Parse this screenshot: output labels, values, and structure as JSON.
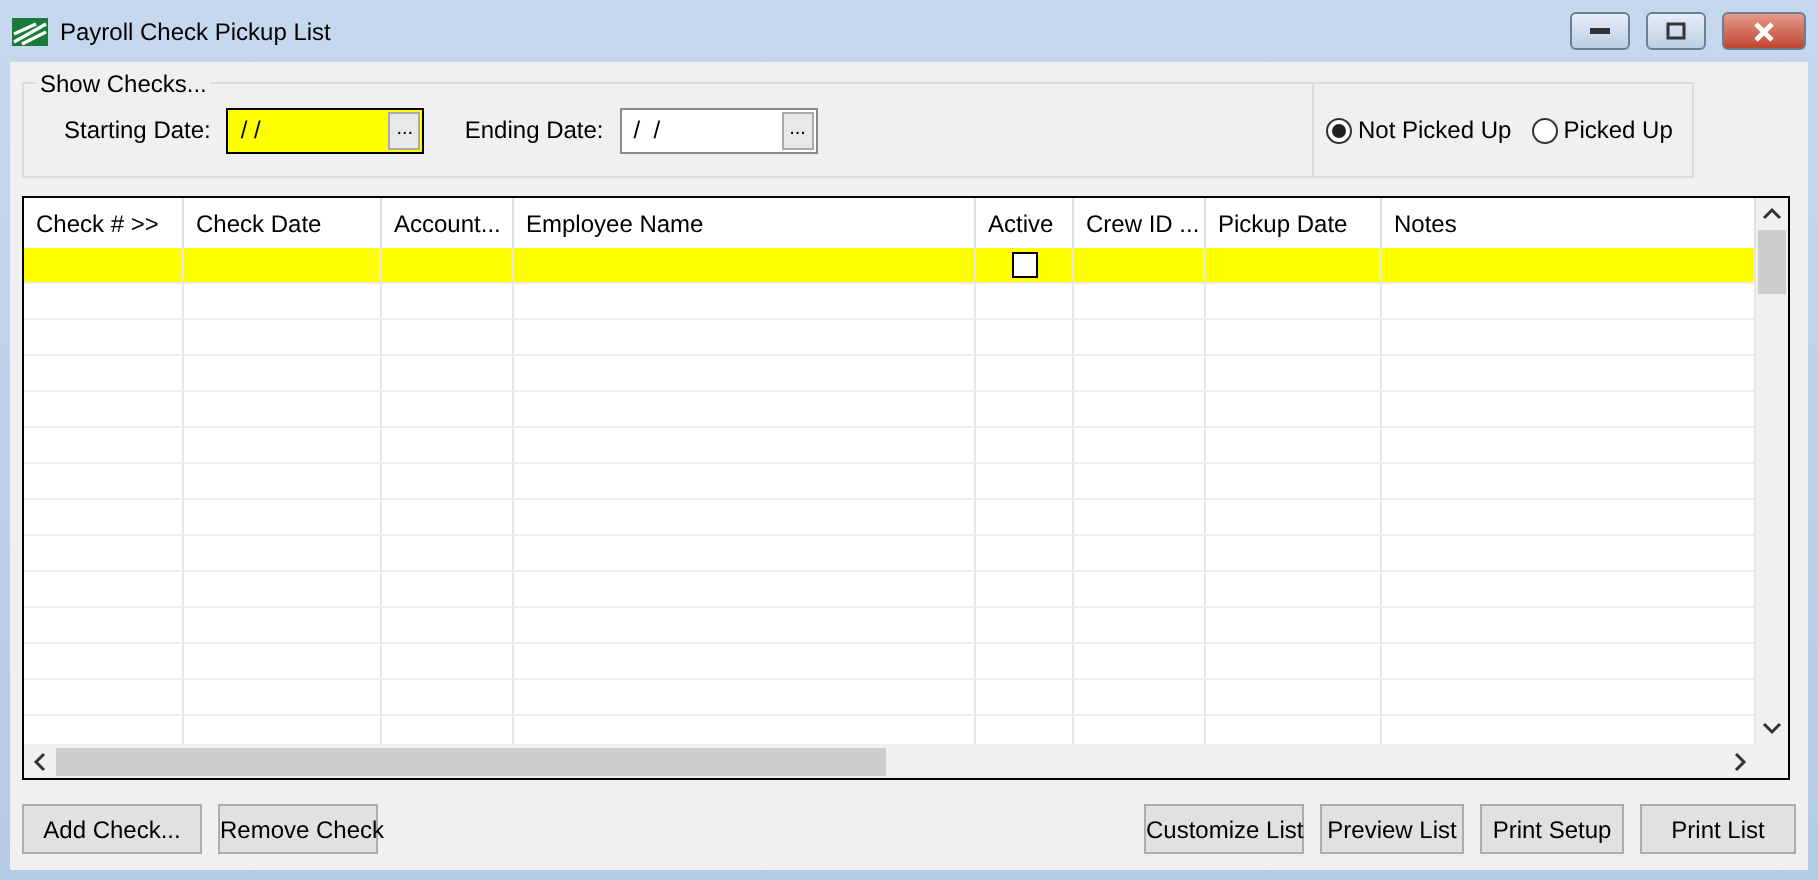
{
  "window": {
    "title": "Payroll Check Pickup List"
  },
  "show_checks": {
    "title": "Show Checks...",
    "starting_date": {
      "label": "Starting Date:",
      "value": "/ /",
      "highlighted": true
    },
    "ending_date": {
      "label": "Ending Date:",
      "value": "/  /",
      "highlighted": false
    },
    "browse_label": "...",
    "radios": [
      {
        "label": "Not Picked Up",
        "selected": true
      },
      {
        "label": "Picked Up",
        "selected": false
      }
    ]
  },
  "table": {
    "columns": [
      "Check # >>",
      "Check Date",
      "Account...",
      "Employee Name",
      "Active",
      "Crew ID ...",
      "Pickup Date",
      "Notes"
    ],
    "rows": [
      {
        "selected": true,
        "active": false
      }
    ]
  },
  "buttons_left": [
    "Add Check...",
    "Remove Check"
  ],
  "buttons_right": [
    "Customize List",
    "Preview List",
    "Print Setup",
    "Print List"
  ]
}
